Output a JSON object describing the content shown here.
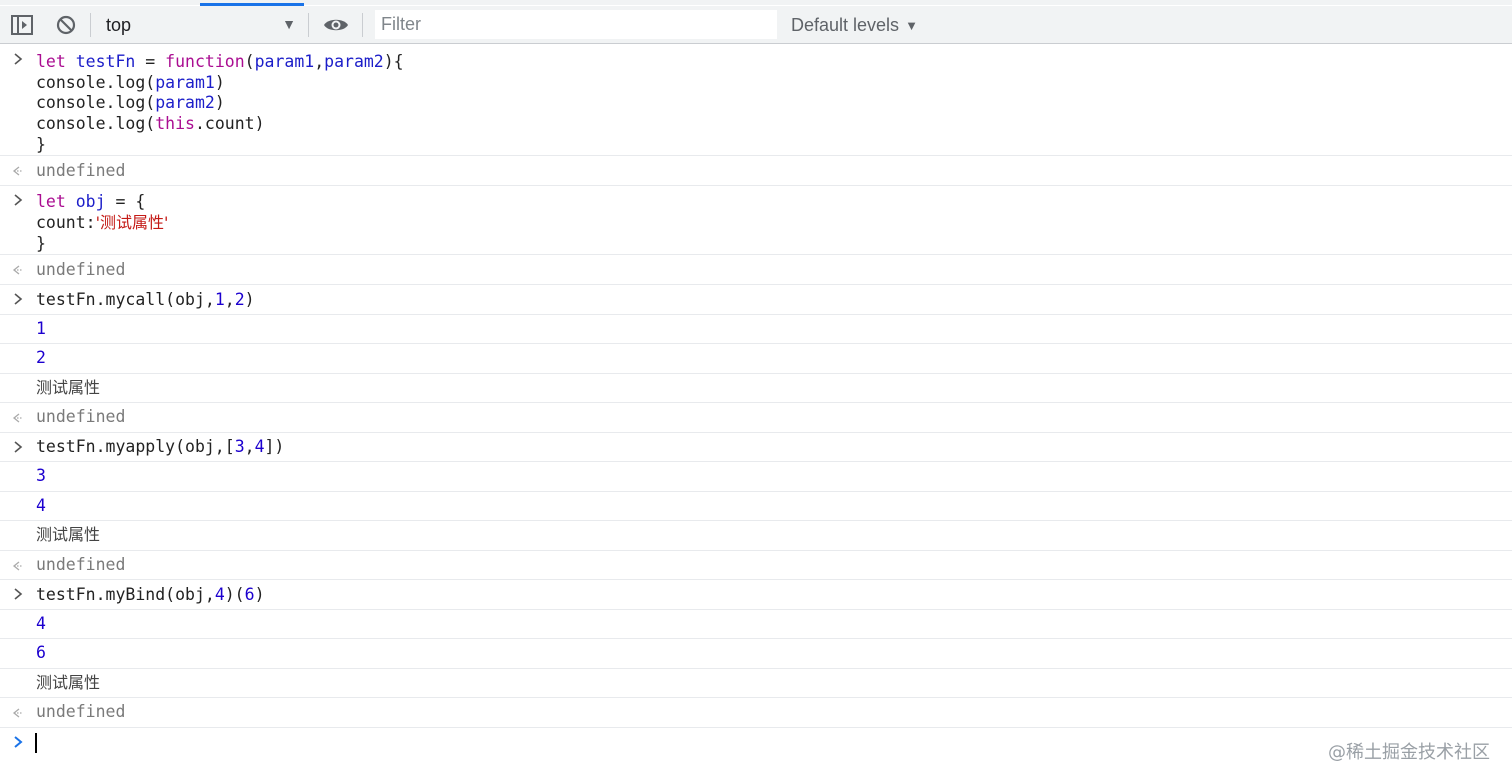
{
  "toolbar": {
    "context_value": "top",
    "filter_placeholder": "Filter",
    "levels_label": "Default levels"
  },
  "icons": {
    "sidebar": "sidebar-toggle-icon",
    "clear": "clear-console-icon",
    "eye": "eye-icon",
    "prompt": "chevron-right-icon",
    "result": "result-arrow-icon",
    "dropdown": "dropdown-arrow-icon"
  },
  "colors": {
    "keyword": "#aa0d91",
    "name": "#1c00cf",
    "string": "#c41a16",
    "number": "#1c00cf",
    "muted": "#7a7a7a",
    "accent": "#1a73e8"
  },
  "console": {
    "entry1": {
      "l1_kw": "let",
      "l1_name": "testFn",
      "l1_eq": " = ",
      "l1_fn": "function",
      "l1_args_open": "(",
      "l1_p1": "param1",
      "l1_comma": ",",
      "l1_p2": "param2",
      "l1_close": "){",
      "l2_a": "console.log(",
      "l2_p": "param1",
      "l2_b": ")",
      "l3_a": "console.log(",
      "l3_p": "param2",
      "l3_b": ")",
      "l4_a": "console.log(",
      "l4_this": "this",
      "l4_b": ".count)",
      "l5": "}"
    },
    "result1": "undefined",
    "entry2": {
      "l1_kw": "let",
      "l1_name": "obj",
      "l1_eq": " = {",
      "l2_key": "count:",
      "l2_str": "'测试属性'",
      "l3": "}"
    },
    "result2": "undefined",
    "call": {
      "a": "testFn.mycall(obj,",
      "n1": "1",
      "c": ",",
      "n2": "2",
      "b": ")",
      "out1": "1",
      "out2": "2",
      "out3": "测试属性",
      "result": "undefined"
    },
    "apply": {
      "a": "testFn.myapply(obj,[",
      "n1": "3",
      "c": ",",
      "n2": "4",
      "b": "])",
      "out1": "3",
      "out2": "4",
      "out3": "测试属性",
      "result": "undefined"
    },
    "bind": {
      "a": "testFn.myBind(obj,",
      "n1": "4",
      "m": ")(",
      "n2": "6",
      "b": ")",
      "out1": "4",
      "out2": "6",
      "out3": "测试属性",
      "result": "undefined"
    }
  },
  "watermark": "@稀土掘金技术社区"
}
